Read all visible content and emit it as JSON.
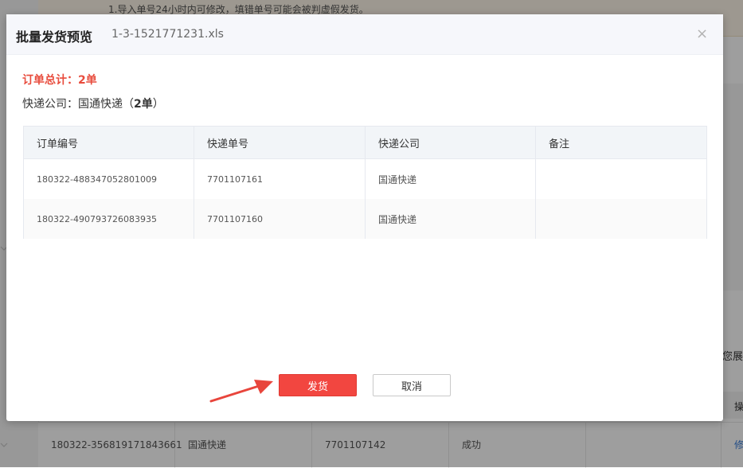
{
  "background": {
    "notice": "1.导入单号24小时内可修改，填错单号可能会被判虚假发货。",
    "side_text": "您展",
    "side_header": "操",
    "row": {
      "order_no": "180322-356819171843661",
      "company": "国通快递",
      "tracking_no": "7701107142",
      "status": "成功",
      "action": "修"
    }
  },
  "modal": {
    "title": "批量发货预览",
    "filename": "1-3-1521771231.xls",
    "close_glyph": "×",
    "summary_total": "订单总计：2单",
    "company_label": "快递公司：国通快递（",
    "company_count": "2单",
    "company_close": "）",
    "table": {
      "headers": [
        "订单编号",
        "快递单号",
        "快递公司",
        "备注"
      ],
      "rows": [
        {
          "order_no": "180322-488347052801009",
          "tracking_no": "7701107161",
          "company": "国通快递",
          "note": ""
        },
        {
          "order_no": "180322-490793726083935",
          "tracking_no": "7701107160",
          "company": "国通快递",
          "note": ""
        }
      ]
    },
    "ship_button": "发货",
    "cancel_button": "取消"
  },
  "colors": {
    "accent_red": "#f24640",
    "summary_red": "#e84c3d",
    "arrow_red": "#e8453c"
  }
}
